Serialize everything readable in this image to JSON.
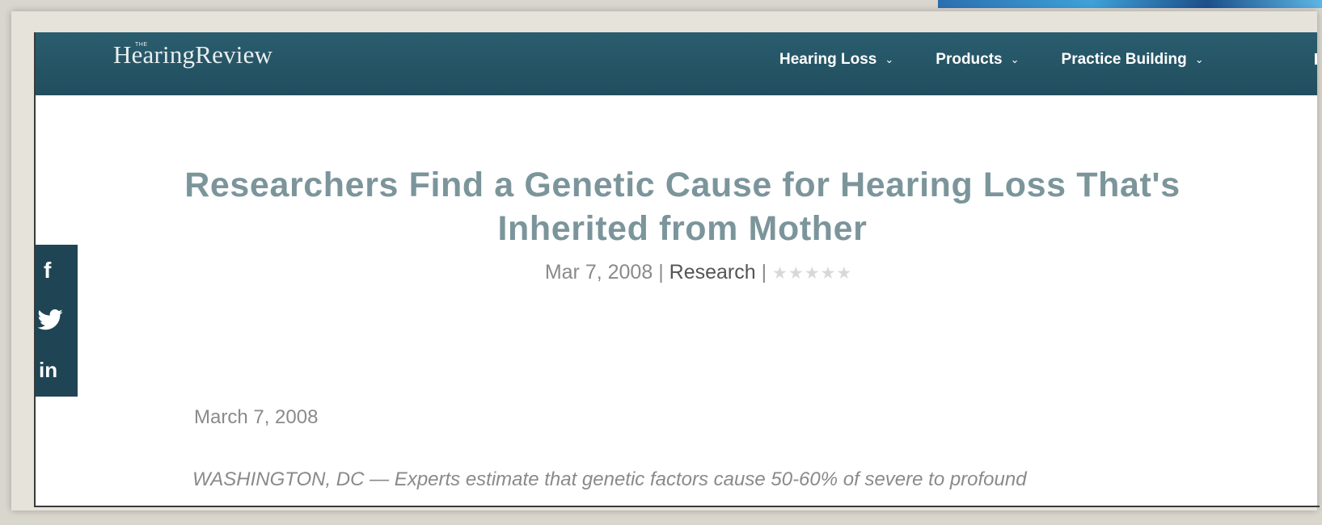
{
  "site": {
    "logo_prefix": "THE",
    "logo_name": "HearingReview"
  },
  "nav": {
    "items": [
      {
        "label": "Hearing Loss"
      },
      {
        "label": "Products"
      },
      {
        "label": "Practice Building"
      }
    ]
  },
  "article": {
    "title": "Researchers Find a Genetic Cause for Hearing Loss That's Inherited from Mother",
    "date": "Mar 7, 2008",
    "separator": "|",
    "category": "Research",
    "rating": 0,
    "dateline": "March 7, 2008",
    "lead_location": "WASHINGTON, DC",
    "lead_text": " — Experts estimate that genetic factors cause 50-60% of severe to profound"
  },
  "share": {
    "icons": [
      "facebook-icon",
      "twitter-icon",
      "linkedin-icon"
    ]
  }
}
